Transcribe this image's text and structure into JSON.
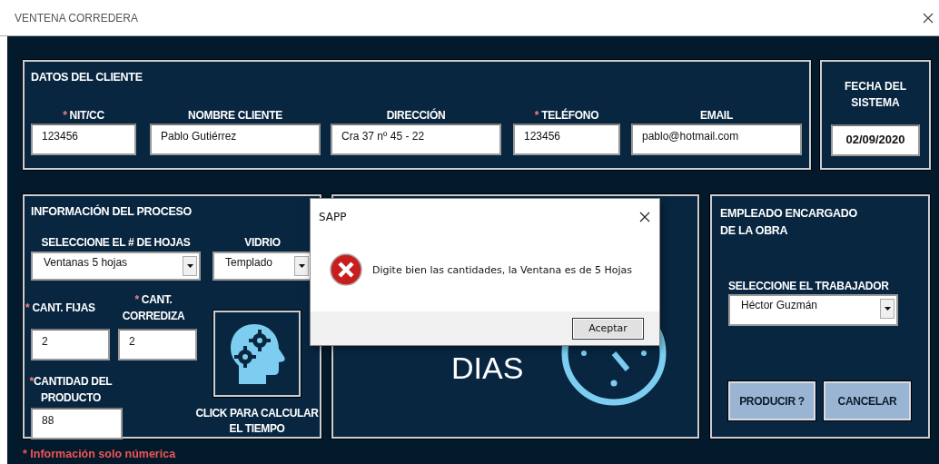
{
  "window": {
    "title": "VENTENA CORREDERA"
  },
  "cliente": {
    "heading": "DATOS DEL CLIENTE",
    "fields": [
      {
        "mark": "*",
        "label": "NIT/CC",
        "value": "123456"
      },
      {
        "label": "NOMBRE CLIENTE",
        "value": "Pablo Gutiérrez"
      },
      {
        "label": "DIRECCIÓN",
        "value": "Cra 37 nº 45 - 22"
      },
      {
        "mark": "*",
        "label": "TELÉFONO",
        "value": "123456"
      },
      {
        "label": "EMAIL",
        "value": "pablo@hotmail.com"
      }
    ]
  },
  "fecha": {
    "heading": "FECHA DEL SISTEMA",
    "value": "02/09/2020"
  },
  "proceso": {
    "heading": "INFORMACIÓN DEL PROCESO",
    "hojas": {
      "label": "SELECCIONE EL # DE HOJAS",
      "value": "Ventanas 5 hojas"
    },
    "vidrio": {
      "label": "VIDRIO",
      "value": "Templado"
    },
    "fijas": {
      "mark": "*",
      "label": "CANT. FIJAS",
      "value": "2"
    },
    "corrediza": {
      "mark": "*",
      "label": "CANT. CORREDIZA",
      "value": "2"
    },
    "cantidad": {
      "mark": "*",
      "label": "CANTIDAD DEL PRODUCTO",
      "value": "88"
    },
    "calc_caption": "CLICK PARA CALCULAR EL TIEMPO"
  },
  "tiempo": {
    "unit": "DIAS"
  },
  "empleado": {
    "heading": "EMPLEADO ENCARGADO DE LA OBRA",
    "trabajador": {
      "label": "SELECCIONE EL TRABAJADOR",
      "value": "Héctor Guzmán"
    },
    "buttons": [
      "PRODUCIR ?",
      "CANCELAR"
    ]
  },
  "note": "* Información solo númerica",
  "dialog": {
    "title": "SAPP",
    "message": "Digite bien las cantidades, la Ventana es de 5 Hojas",
    "button": "Aceptar"
  }
}
